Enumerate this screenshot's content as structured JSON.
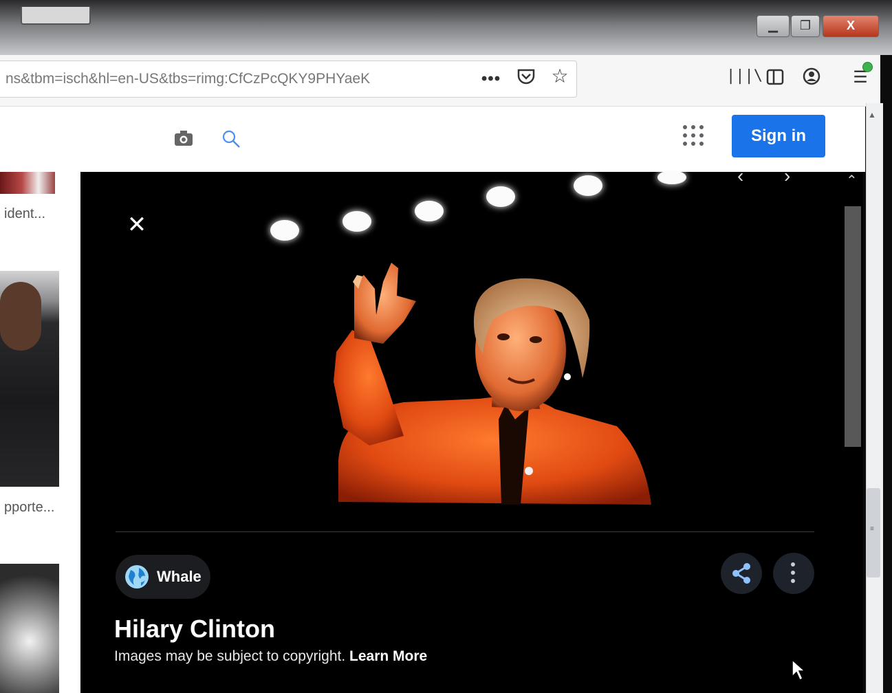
{
  "browser": {
    "url": "ns&tbm=isch&hl=en-US&tbs=rimg:CfCzPcQKY9PHYaeK",
    "window_controls": {
      "close_label": "X"
    },
    "toolbar_icons": [
      "more-icon",
      "pocket-icon",
      "star-icon",
      "library-icon",
      "sidebar-icon",
      "account-icon",
      "menu-icon"
    ]
  },
  "google_header": {
    "signin_label": "Sign in",
    "signin_color": "#1a73e8"
  },
  "results": {
    "captions": [
      "ident...",
      "pporte..."
    ]
  },
  "viewer": {
    "source_name": "Whale",
    "title": "Hilary Clinton",
    "copyright_text": "Images may be subject to copyright.",
    "learn_more_label": "Learn More"
  },
  "colors": {
    "viewer_bg": "#000000",
    "jacket": "#e04a12"
  }
}
